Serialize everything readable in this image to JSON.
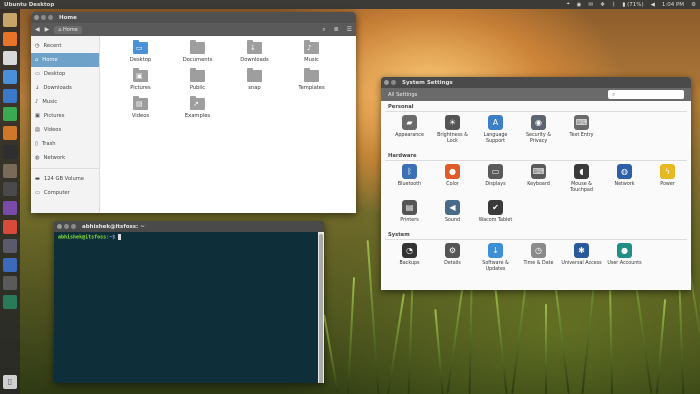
{
  "top_panel": {
    "title": "Ubuntu Desktop",
    "battery": "(71%)",
    "clock": "1:04 PM"
  },
  "files": {
    "title": "Home",
    "path": "Home",
    "sidebar": [
      {
        "label": "Recent",
        "icon": "clock-icon",
        "glyph": "◷"
      },
      {
        "label": "Home",
        "icon": "home-icon",
        "glyph": "⌂"
      },
      {
        "label": "Desktop",
        "icon": "desktop-icon",
        "glyph": "▭"
      },
      {
        "label": "Downloads",
        "icon": "download-icon",
        "glyph": "↓"
      },
      {
        "label": "Music",
        "icon": "music-icon",
        "glyph": "♪"
      },
      {
        "label": "Pictures",
        "icon": "picture-icon",
        "glyph": "▣"
      },
      {
        "label": "Videos",
        "icon": "video-icon",
        "glyph": "▤"
      },
      {
        "label": "Trash",
        "icon": "trash-icon",
        "glyph": "▯"
      },
      {
        "label": "Network",
        "icon": "network-icon",
        "glyph": "◍"
      },
      {
        "label": "124 GB Volume",
        "icon": "drive-icon",
        "glyph": "▬"
      },
      {
        "label": "Computer",
        "icon": "computer-icon",
        "glyph": "▭"
      }
    ],
    "items": [
      {
        "label": "Desktop",
        "glyph": "▭"
      },
      {
        "label": "Documents",
        "glyph": ""
      },
      {
        "label": "Downloads",
        "glyph": "↓"
      },
      {
        "label": "Music",
        "glyph": "♪"
      },
      {
        "label": "Pictures",
        "glyph": "▣"
      },
      {
        "label": "Public",
        "glyph": ""
      },
      {
        "label": "snap",
        "glyph": ""
      },
      {
        "label": "Templates",
        "glyph": ""
      },
      {
        "label": "Videos",
        "glyph": "▤"
      },
      {
        "label": "Examples",
        "glyph": "↗"
      }
    ]
  },
  "terminal": {
    "title": "abhishek@itsfoss: ~",
    "user": "abhishek@itsfoss",
    "path": ":~$"
  },
  "settings": {
    "title": "System Settings",
    "all_settings": "All Settings",
    "sections": [
      {
        "title": "Personal",
        "items": [
          {
            "label": "Appearance",
            "icon": "appearance-icon",
            "glyph": "▰",
            "color": "#6b6b6b"
          },
          {
            "label": "Brightness & Lock",
            "icon": "brightness-icon",
            "glyph": "☀",
            "color": "#555555"
          },
          {
            "label": "Language Support",
            "icon": "language-icon",
            "glyph": "A",
            "color": "#3e7ec4"
          },
          {
            "label": "Security & Privacy",
            "icon": "security-icon",
            "glyph": "◉",
            "color": "#5b6470"
          },
          {
            "label": "Text Entry",
            "icon": "keyboard-icon",
            "glyph": "⌨",
            "color": "#6a6a6a"
          }
        ]
      },
      {
        "title": "Hardware",
        "items": [
          {
            "label": "Bluetooth",
            "icon": "bluetooth-icon",
            "glyph": "ᛒ",
            "color": "#3c6fb4"
          },
          {
            "label": "Color",
            "icon": "color-icon",
            "glyph": "●",
            "color": "#e05a2a"
          },
          {
            "label": "Displays",
            "icon": "display-icon",
            "glyph": "▭",
            "color": "#5a5a5a"
          },
          {
            "label": "Keyboard",
            "icon": "keyboard-icon",
            "glyph": "⌨",
            "color": "#5a5a5a"
          },
          {
            "label": "Mouse & Touchpad",
            "icon": "mouse-icon",
            "glyph": "◖",
            "color": "#3a3a3a"
          },
          {
            "label": "Network",
            "icon": "network-icon",
            "glyph": "◍",
            "color": "#2f5ea8"
          },
          {
            "label": "Power",
            "icon": "power-icon",
            "glyph": "ϟ",
            "color": "#e8b820"
          },
          {
            "label": "Printers",
            "icon": "printer-icon",
            "glyph": "▤",
            "color": "#555555"
          },
          {
            "label": "Sound",
            "icon": "sound-icon",
            "glyph": "◀",
            "color": "#4a6a8a"
          },
          {
            "label": "Wacom Tablet",
            "icon": "tablet-icon",
            "glyph": "✔",
            "color": "#3a3a3a"
          }
        ]
      },
      {
        "title": "System",
        "items": [
          {
            "label": "Backups",
            "icon": "backup-icon",
            "glyph": "◔",
            "color": "#333333"
          },
          {
            "label": "Details",
            "icon": "gear-icon",
            "glyph": "⚙",
            "color": "#555555"
          },
          {
            "label": "Software & Updates",
            "icon": "software-icon",
            "glyph": "↓",
            "color": "#3d8fd6"
          },
          {
            "label": "Time & Date",
            "icon": "clock-icon",
            "glyph": "◷",
            "color": "#8a8a8a"
          },
          {
            "label": "Universal Access",
            "icon": "accessibility-icon",
            "glyph": "✱",
            "color": "#2a5a9a"
          },
          {
            "label": "User Accounts",
            "icon": "user-icon",
            "glyph": "●",
            "color": "#1f8f86"
          }
        ]
      }
    ]
  },
  "launcher": [
    {
      "icon": "files-icon",
      "color": "#c8a468"
    },
    {
      "icon": "firefox-icon",
      "color": "#e8742a"
    },
    {
      "icon": "chrome-icon",
      "color": "#d9d9d9"
    },
    {
      "icon": "folder-icon",
      "color": "#4a90d9"
    },
    {
      "icon": "writer-icon",
      "color": "#3a78c8"
    },
    {
      "icon": "calc-icon",
      "color": "#3aa94f"
    },
    {
      "icon": "impress-icon",
      "color": "#d0782a"
    },
    {
      "icon": "terminal-icon",
      "color": "#2e2e2e"
    },
    {
      "icon": "gimp-icon",
      "color": "#7a6a5a"
    },
    {
      "icon": "app-icon",
      "color": "#4a4a4a"
    },
    {
      "icon": "tweaks-icon",
      "color": "#7a4aa8"
    },
    {
      "icon": "maps-icon",
      "color": "#d84a3a"
    },
    {
      "icon": "settings-icon",
      "color": "#5a5a6a"
    },
    {
      "icon": "disc-icon",
      "color": "#3a6ab8"
    },
    {
      "icon": "media-icon",
      "color": "#5a5a5a"
    },
    {
      "icon": "screenshot-icon",
      "color": "#2a7a5a"
    }
  ]
}
